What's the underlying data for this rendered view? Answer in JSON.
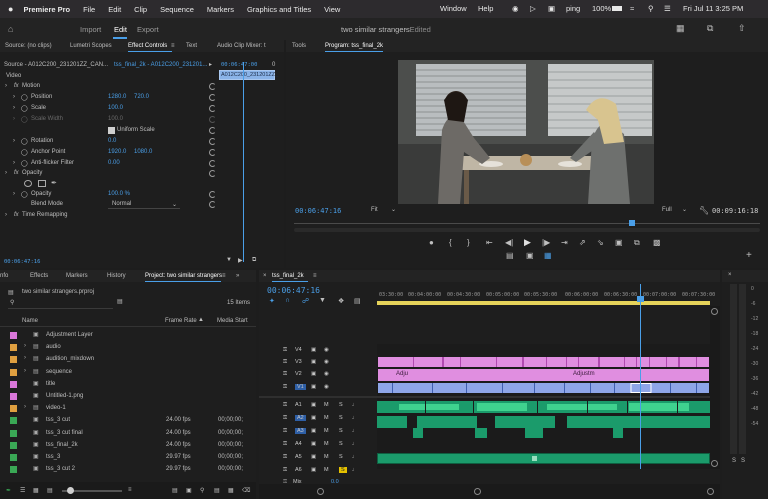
{
  "menubar": {
    "app_name": "Premiere Pro",
    "items": [
      "File",
      "Edit",
      "Clip",
      "Sequence",
      "Markers",
      "Graphics and Titles",
      "View",
      "Window",
      "Help"
    ],
    "status_user": "ping",
    "battery": "100%",
    "datetime": "Fri Jul 11  3:25 PM"
  },
  "header": {
    "tabs": [
      "Import",
      "Edit",
      "Export"
    ],
    "active_tab": "Edit",
    "doc_title": "two similar strangers",
    "doc_status": "- Edited"
  },
  "left_panel": {
    "tabs": [
      "Source: (no clips)",
      "Lumetri Scopes",
      "Effect Controls",
      "Text",
      "Audio Clip Mixer: t"
    ],
    "source_label": "Source - A012C200_231201ZZ_CAN...",
    "sequence_label": "tss_final_2k - A012C200_231201...",
    "timecode_top": "00:06:47:00",
    "clip_name": "A012C200_231201ZZ_",
    "section_video": "Video",
    "motion": "Motion",
    "position_label": "Position",
    "position_x": "1280.0",
    "position_y": "720.0",
    "scale_label": "Scale",
    "scale_val": "100.0",
    "scale_width_label": "Scale Width",
    "scale_width_val": "100.0",
    "uniform_scale": "Uniform Scale",
    "rotation_label": "Rotation",
    "rotation_val": "0.0",
    "anchor_label": "Anchor Point",
    "anchor_x": "1920.0",
    "anchor_y": "1080.0",
    "flicker_label": "Anti-flicker Filter",
    "flicker_val": "0.00",
    "opacity_section": "Opacity",
    "opacity_label": "Opacity",
    "opacity_val": "100.0 %",
    "blend_label": "Blend Mode",
    "blend_val": "Normal",
    "remap": "Time Remapping",
    "timecode_bottom": "00:06:47:16"
  },
  "program": {
    "tabs": [
      "Tools",
      "Program: tss_final_2k"
    ],
    "timecode": "00:06:47:16",
    "fit": "Fit",
    "full": "Full",
    "duration": "00:09:16:18"
  },
  "project": {
    "tabs": [
      "nfo",
      "Effects",
      "Markers",
      "History",
      "Project: two similar strangers"
    ],
    "file": "two similar strangers.prproj",
    "count": "15 Items",
    "col_name": "Name",
    "col_rate": "Frame Rate",
    "col_start": "Media Start",
    "items": [
      {
        "name": "Adjustment Layer",
        "rate": "",
        "start": "",
        "color": "#d977d9"
      },
      {
        "name": "audio",
        "rate": "",
        "start": "",
        "color": "#e0a040"
      },
      {
        "name": "audition_mixdown",
        "rate": "",
        "start": "",
        "color": "#e0a040"
      },
      {
        "name": "sequence",
        "rate": "",
        "start": "",
        "color": "#e0a040"
      },
      {
        "name": "title",
        "rate": "",
        "start": "",
        "color": "#d977d9"
      },
      {
        "name": "Untitled-1.png",
        "rate": "",
        "start": "",
        "color": "#d977d9"
      },
      {
        "name": "video-1",
        "rate": "",
        "start": "",
        "color": "#e0a040"
      },
      {
        "name": "tss_3 cut",
        "rate": "24.00 fps",
        "start": "00;00;00;",
        "color": "#3aa855"
      },
      {
        "name": "tss_3 cut final",
        "rate": "24.00 fps",
        "start": "00;00;00;",
        "color": "#3aa855"
      },
      {
        "name": "tss_final_2k",
        "rate": "24.00 fps",
        "start": "00;00;00;",
        "color": "#3aa855"
      },
      {
        "name": "tss_3",
        "rate": "29.97 fps",
        "start": "00;00;00;",
        "color": "#3aa855"
      },
      {
        "name": "tss_3 cut 2",
        "rate": "29.97 fps",
        "start": "00;00;00;",
        "color": "#3aa855"
      }
    ]
  },
  "timeline": {
    "tab": "tss_final_2k",
    "timecode": "00:06:47:16",
    "ruler": [
      "03:30:00",
      "00:04:00:00",
      "00:04:30:00",
      "00:05:00:00",
      "00:05:30:00",
      "00:06:00:00",
      "00:06:30:00",
      "00:07:00:00",
      "00:07:30:00"
    ],
    "video_tracks": [
      "V4",
      "V3",
      "V2",
      "V1"
    ],
    "audio_tracks": [
      "A1",
      "A2",
      "A3",
      "A4",
      "A5",
      "A6"
    ],
    "mix_label": "Mix",
    "mix_val": "0.0",
    "clip_labels": [
      "Adju",
      "Adjustm"
    ]
  },
  "meter": {
    "labels": [
      "0",
      "-6",
      "-12",
      "-18",
      "-24",
      "-30",
      "-36",
      "-42",
      "-48",
      "-54"
    ],
    "solo": [
      "S",
      "S"
    ]
  },
  "colors": {
    "accent": "#4a9fe8",
    "panel": "#1e1e1e",
    "video_clip": "#e08ee0",
    "v1_clip": "#8ea6e8",
    "audio_clip": "#1b9b6b"
  }
}
